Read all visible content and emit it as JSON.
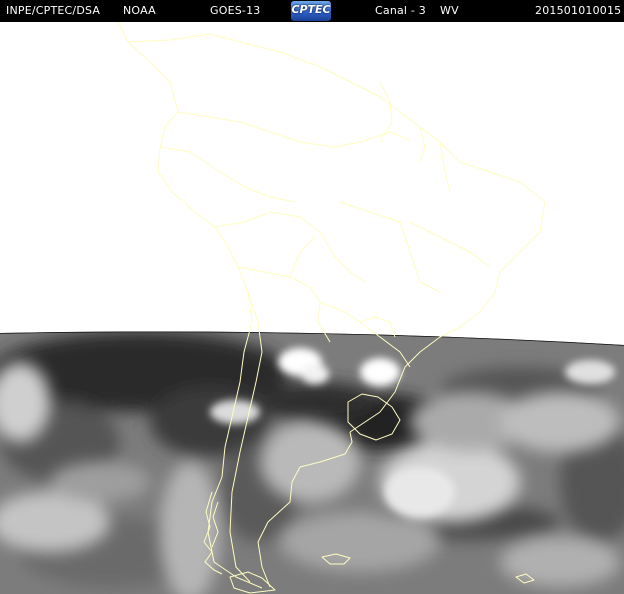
{
  "header": {
    "agency": "INPE/CPTEC/DSA",
    "partner": "NOAA",
    "satellite": "GOES-13",
    "logo_text": "CPTEC",
    "channel": "Canal - 3",
    "band": "WV",
    "timestamp": "201501010015"
  },
  "colors": {
    "header_background": "#000000",
    "header_text": "#ffffff",
    "outside_disk": "#ffffff",
    "boundaries": "#fffcc0"
  }
}
